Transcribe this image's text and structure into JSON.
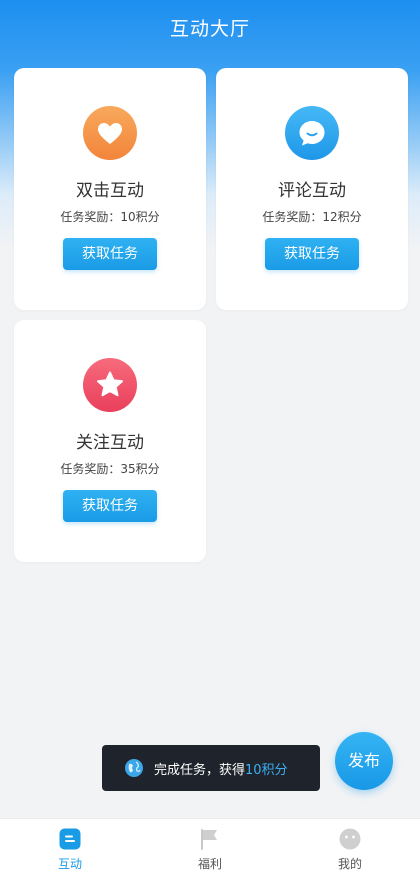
{
  "header": {
    "title": "互动大厅"
  },
  "cards": [
    {
      "name": "双击互动",
      "reward": "任务奖励：10积分",
      "button": "获取任务",
      "icon": "heart-icon",
      "color": "#f5974a"
    },
    {
      "name": "评论互动",
      "reward": "任务奖励：12积分",
      "button": "获取任务",
      "icon": "chat-bubble-icon",
      "color": "#33a9ef"
    },
    {
      "name": "关注互动",
      "reward": "任务奖励：35积分",
      "button": "获取任务",
      "icon": "star-icon",
      "color": "#f0566e"
    }
  ],
  "toast": {
    "text": "完成任务，获得",
    "highlight": "10积分"
  },
  "fab": {
    "label": "发布"
  },
  "tabbar": {
    "items": [
      {
        "label": "互动",
        "icon": "interaction-icon",
        "active": true
      },
      {
        "label": "福利",
        "icon": "flag-icon",
        "active": false
      },
      {
        "label": "我的",
        "icon": "profile-face-icon",
        "active": false
      }
    ]
  },
  "colors": {
    "accent": "#1a9be6",
    "header_top": "#1d8ff0",
    "toast_bg": "#1f232b"
  }
}
